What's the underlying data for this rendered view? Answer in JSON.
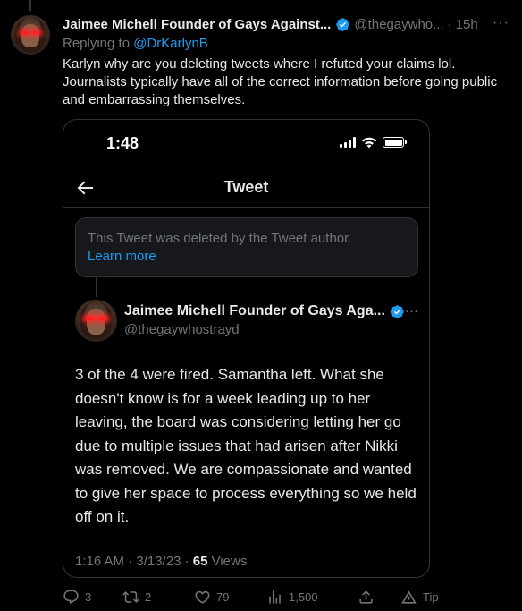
{
  "tweet": {
    "author_name": "Jaimee Michell Founder of Gays Against...",
    "handle": "@thegaywho...",
    "separator": "·",
    "time": "15h",
    "more": "···",
    "replying_prefix": "Replying to ",
    "replying_to": "@DrKarlynB",
    "text": "Karlyn why are you deleting tweets where I refuted your claims lol. Journalists typically have all of the correct information before going public and embarrassing themselves."
  },
  "screenshot": {
    "status_time": "1:48",
    "nav_title": "Tweet",
    "deleted_notice": "This Tweet was deleted by the Tweet author.",
    "learn_more": "Learn more",
    "inner_author_name": "Jaimee Michell Founder of Gays Aga...",
    "inner_handle": "@thegaywhostrayd",
    "inner_more": "···",
    "inner_text": "3 of the 4 were fired. Samantha left. What she doesn't know is for a week leading up to her leaving, the board was considering letting her go due to multiple issues that had arisen after Nikki was removed. We are compassionate and wanted to give her space to process everything so we held off on it.",
    "meta_time": "1:16 AM · 3/13/23 · ",
    "views_count": "65",
    "views_label": " Views"
  },
  "actions": {
    "reply_count": "3",
    "retweet_count": "2",
    "like_count": "79",
    "views_count": "1,500",
    "tip_label": "Tip"
  },
  "colors": {
    "background": "#000000",
    "text_primary": "#e7e9ea",
    "text_secondary": "#71767b",
    "accent": "#1d9bf0",
    "border": "#2f3336",
    "verified": "#1d9bf0"
  }
}
